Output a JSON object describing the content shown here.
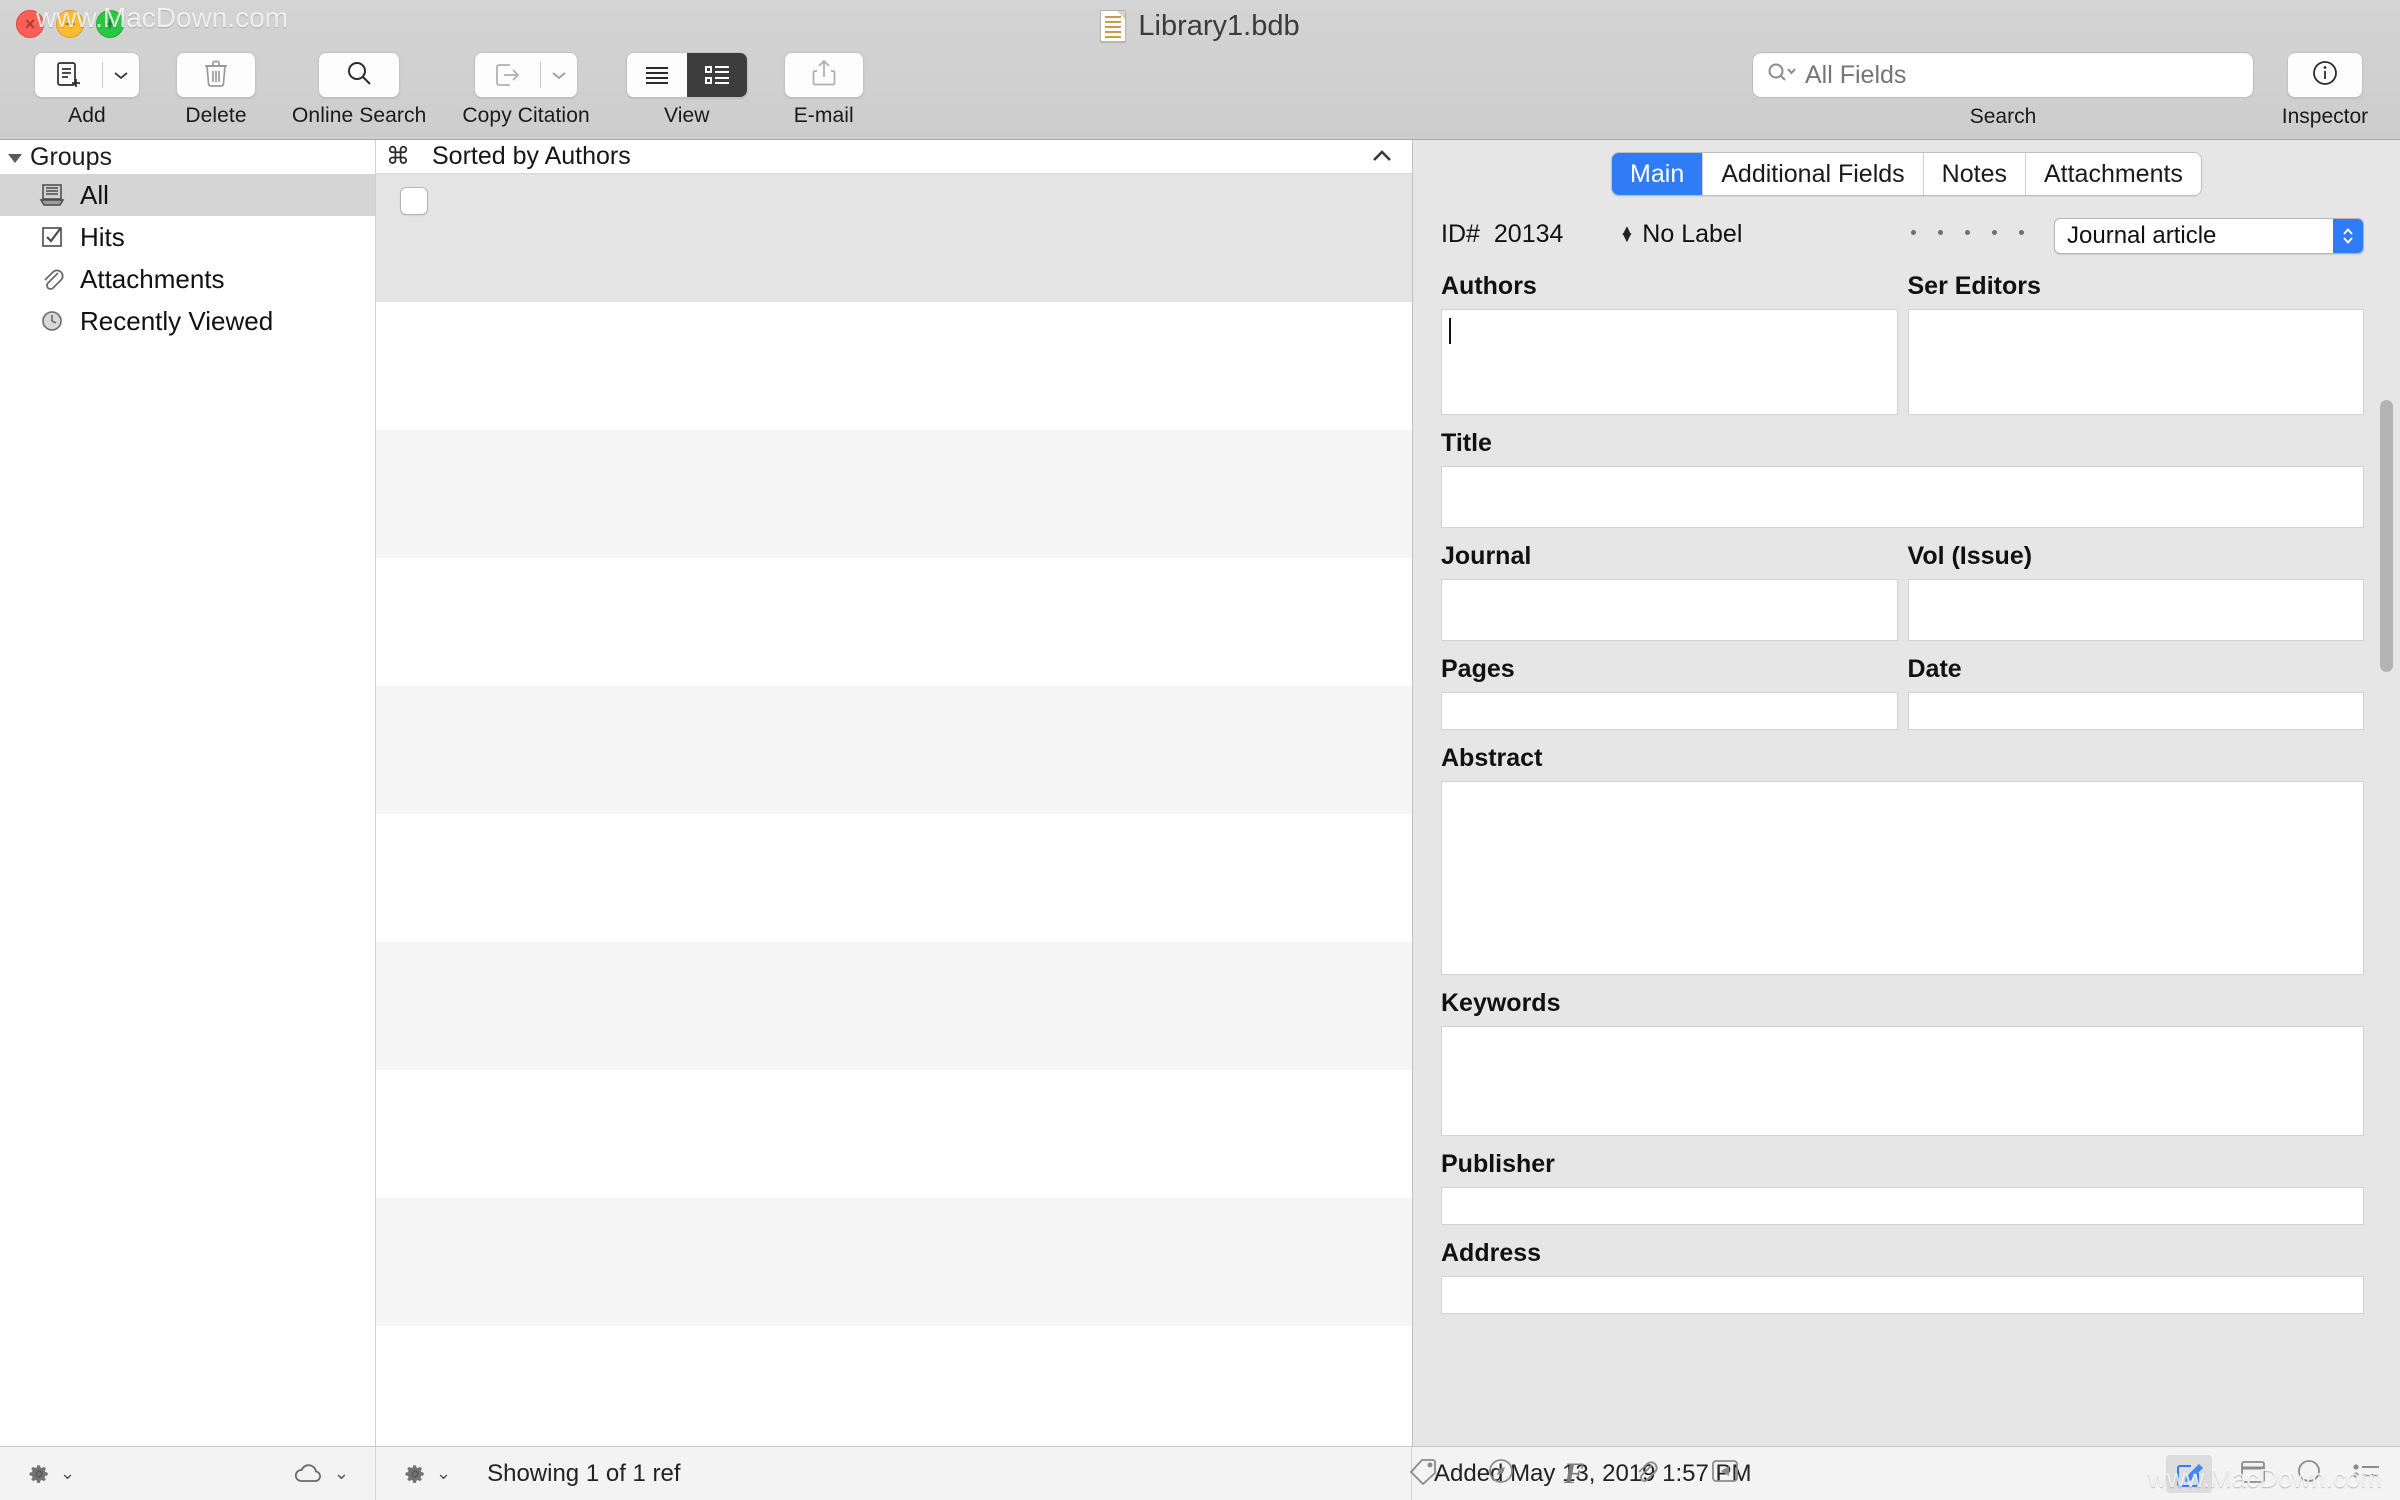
{
  "window": {
    "title": "Library1.bdb",
    "traffic_lights": [
      "close",
      "minimize",
      "zoom"
    ],
    "watermark": "www.MacDown.com"
  },
  "toolbar": {
    "items": [
      {
        "label": "Add",
        "icon": "add-reference-icon",
        "has_dropdown": true
      },
      {
        "label": "Delete",
        "icon": "trash-icon",
        "has_dropdown": false
      },
      {
        "label": "Online Search",
        "icon": "magnifier-icon",
        "has_dropdown": false
      },
      {
        "label": "Copy Citation",
        "icon": "export-arrow-icon",
        "has_dropdown": true
      },
      {
        "label": "View",
        "icon": "view-segmented-icon",
        "has_dropdown": false
      },
      {
        "label": "E-mail",
        "icon": "share-up-icon",
        "has_dropdown": false
      }
    ],
    "view_segments": [
      {
        "name": "paragraph-view",
        "active": false
      },
      {
        "name": "list-view",
        "active": true
      }
    ],
    "search": {
      "placeholder": "All Fields",
      "value": "",
      "label": "Search",
      "icon": "search-scope-icon"
    },
    "inspector": {
      "label": "Inspector",
      "icon": "info-circle-icon"
    }
  },
  "sidebar": {
    "header": "Groups",
    "items": [
      {
        "label": "All",
        "icon": "library-icon",
        "selected": true
      },
      {
        "label": "Hits",
        "icon": "checkbox-icon",
        "selected": false
      },
      {
        "label": "Attachments",
        "icon": "paperclip-icon",
        "selected": false
      },
      {
        "label": "Recently Viewed",
        "icon": "clock-icon",
        "selected": false
      }
    ]
  },
  "list": {
    "sort_header": "Sorted by Authors",
    "sort_glyph": "⌘",
    "collapse_icon": "chevron-up-icon",
    "rows": [
      {
        "selected": true,
        "checkbox": true
      },
      {
        "selected": false,
        "checkbox": false
      },
      {
        "selected": false,
        "checkbox": false
      },
      {
        "selected": false,
        "checkbox": false
      },
      {
        "selected": false,
        "checkbox": false
      },
      {
        "selected": false,
        "checkbox": false
      },
      {
        "selected": false,
        "checkbox": false
      },
      {
        "selected": false,
        "checkbox": false
      },
      {
        "selected": false,
        "checkbox": false
      },
      {
        "selected": false,
        "checkbox": false
      }
    ]
  },
  "inspector": {
    "tabs": [
      {
        "label": "Main",
        "active": true
      },
      {
        "label": "Additional Fields",
        "active": false
      },
      {
        "label": "Notes",
        "active": false
      },
      {
        "label": "Attachments",
        "active": false
      }
    ],
    "id_label": "ID#",
    "id_value": "20134",
    "label_popup": "No Label",
    "type_popup": "Journal article",
    "fields": {
      "authors": {
        "label": "Authors",
        "value": "",
        "focused": true
      },
      "ser_editors": {
        "label": "Ser Editors",
        "value": ""
      },
      "title": {
        "label": "Title",
        "value": ""
      },
      "journal": {
        "label": "Journal",
        "value": ""
      },
      "vol_issue": {
        "label": "Vol (Issue)",
        "value": ""
      },
      "pages": {
        "label": "Pages",
        "value": ""
      },
      "date": {
        "label": "Date",
        "value": ""
      },
      "abstract": {
        "label": "Abstract",
        "value": ""
      },
      "keywords": {
        "label": "Keywords",
        "value": ""
      },
      "publisher": {
        "label": "Publisher",
        "value": ""
      },
      "address": {
        "label": "Address",
        "value": ""
      }
    }
  },
  "statusbar": {
    "left_gear": "gear-icon",
    "cloud": "cloud-icon",
    "mid_gear": "gear-icon",
    "showing_text": "Showing 1 of 1 ref",
    "mid_icons": [
      {
        "name": "tag-icon"
      },
      {
        "name": "compass-icon"
      },
      {
        "name": "font-format-icon",
        "glyph": "F"
      },
      {
        "name": "paperclip-icon"
      },
      {
        "name": "collapse-left-icon"
      }
    ],
    "added_text": "Added May 13, 2019 1:57 PM",
    "right_icons": [
      {
        "name": "edit-pencil-icon",
        "active": true
      },
      {
        "name": "calendar-icon",
        "active": false
      },
      {
        "name": "circle-icon",
        "active": false
      },
      {
        "name": "list-dash-icon",
        "active": false
      }
    ]
  },
  "colors": {
    "accent": "#2f7cf6",
    "toolbar_bg": "#d0d0d0",
    "inspector_bg": "#e6e6e6",
    "selected_row": "#e4e4e4"
  }
}
